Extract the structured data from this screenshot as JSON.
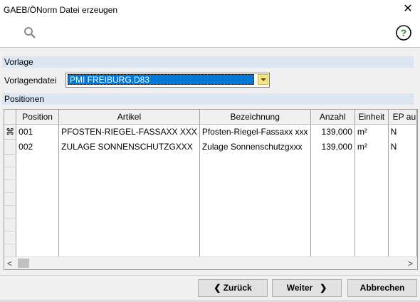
{
  "window": {
    "title": "GAEB/ÖNorm Datei erzeugen"
  },
  "sections": {
    "vorlage": "Vorlage",
    "positionen": "Positionen"
  },
  "vorlage": {
    "label": "Vorlagendatei",
    "value": "PMI FREIBURG.D83"
  },
  "table": {
    "columns": [
      "Position",
      "Artikel",
      "Bezeichnung",
      "Anzahl",
      "Einheit",
      "EP au"
    ],
    "rows": [
      {
        "indicator": "⌘",
        "position": "001",
        "artikel": "PFOSTEN-RIEGEL-FASSAXX XXX",
        "bezeichnung": "Pfosten-Riegel-Fassaxx xxx",
        "anzahl": "139,000",
        "einheit": "m²",
        "ep": "N"
      },
      {
        "indicator": "",
        "position": "002",
        "artikel": "ZULAGE SONNENSCHUTZGXXX",
        "bezeichnung": "Zulage Sonnenschutzgxxx",
        "anzahl": "139,000",
        "einheit": "m²",
        "ep": "N"
      }
    ]
  },
  "buttons": {
    "back": "Zurück",
    "next": "Weiter",
    "cancel": "Abbrechen"
  },
  "icons": {
    "search": "search-icon",
    "help": "help-icon",
    "close": "close-icon"
  },
  "colors": {
    "section_header": "#dce6f2",
    "selection": "#0078d7",
    "combo_button": "#f5e58a",
    "help_green": "#2e8b2e"
  }
}
